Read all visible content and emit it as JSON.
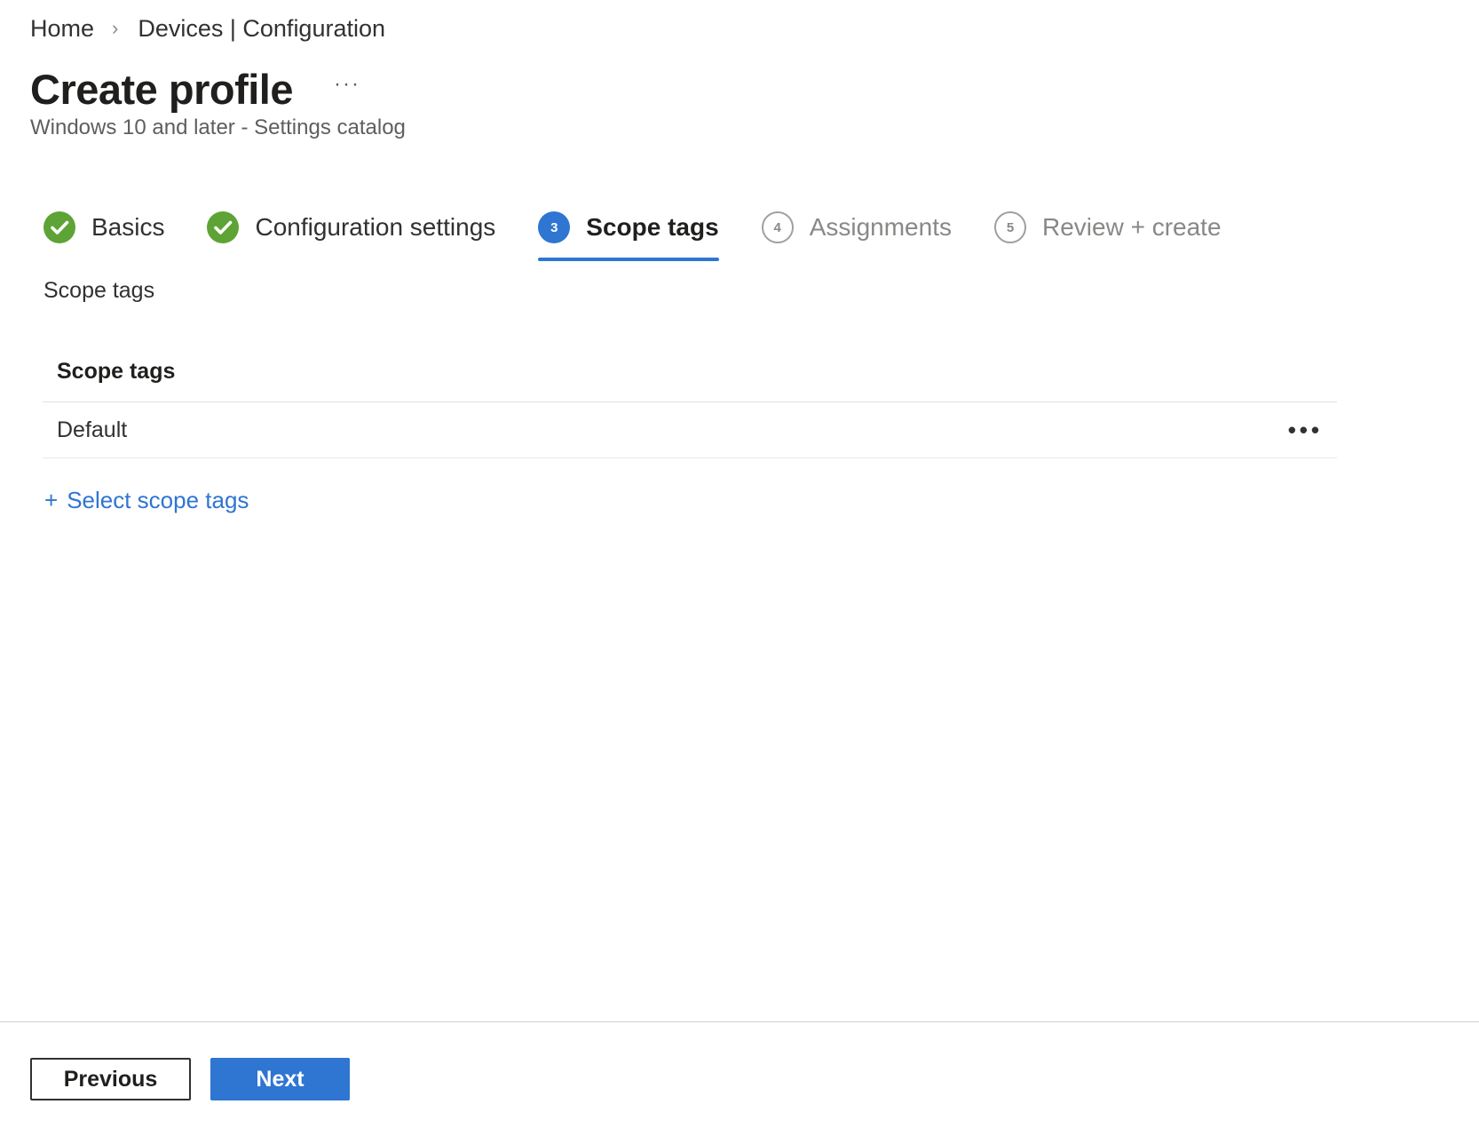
{
  "breadcrumb": {
    "items": [
      "Home",
      "Devices | Configuration"
    ],
    "separator": "›"
  },
  "header": {
    "title": "Create profile",
    "more": "···",
    "subtitle": "Windows 10 and later - Settings catalog"
  },
  "wizard": {
    "steps": [
      {
        "number": "1",
        "label": "Basics",
        "state": "completed"
      },
      {
        "number": "2",
        "label": "Configuration settings",
        "state": "completed"
      },
      {
        "number": "3",
        "label": "Scope tags",
        "state": "current"
      },
      {
        "number": "4",
        "label": "Assignments",
        "state": "upcoming"
      },
      {
        "number": "5",
        "label": "Review + create",
        "state": "upcoming"
      }
    ]
  },
  "content": {
    "section_label": "Scope tags",
    "table": {
      "header": "Scope tags",
      "rows": [
        {
          "name": "Default",
          "more": "•••"
        }
      ]
    },
    "add_link_plus": "+",
    "add_link": "Select scope tags"
  },
  "footer": {
    "previous_label": "Previous",
    "next_label": "Next"
  },
  "colors": {
    "accent": "#2f75d2",
    "success": "#5ea335",
    "text": "#323130",
    "muted": "#8a8886"
  },
  "icons": {
    "completed": "checkmark-circle-icon",
    "breadcrumb_separator": "chevron-right-icon"
  }
}
